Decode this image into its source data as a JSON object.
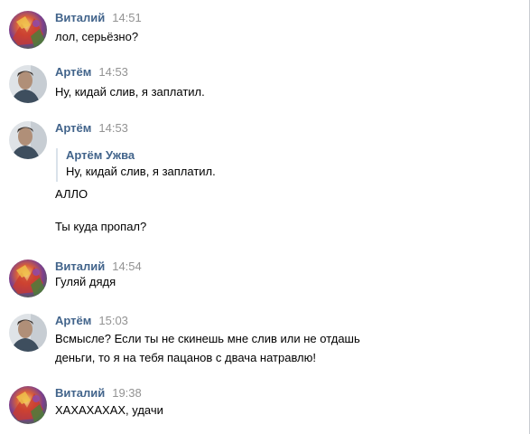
{
  "messages": [
    {
      "author": "Виталий",
      "time": "14:51",
      "avatar_icon": "vitaly-avatar-icon",
      "lines": [
        "лол, серьёзно?"
      ]
    },
    {
      "author": "Артём",
      "time": "14:53",
      "avatar_icon": "artem-avatar-icon",
      "lines": [
        "Ну, кидай слив, я заплатил."
      ]
    },
    {
      "author": "Артём",
      "time": "14:53",
      "avatar_icon": "artem-avatar-icon",
      "quote": {
        "author": "Артём Ужва",
        "text": "Ну, кидай слив, я заплатил."
      },
      "lines": [
        "АЛЛО",
        "Ты куда пропал?"
      ]
    },
    {
      "author": "Виталий",
      "time": "14:54",
      "avatar_icon": "vitaly-avatar-icon",
      "lines": [
        "Гуляй дядя"
      ]
    },
    {
      "author": "Артём",
      "time": "15:03",
      "avatar_icon": "artem-avatar-icon",
      "lines": [
        "Всмысле? Если ты не скинешь мне слив или не отдашь",
        "деньги, то я на тебя пацанов с двача натравлю!"
      ]
    },
    {
      "author": "Виталий",
      "time": "19:38",
      "avatar_icon": "vitaly-avatar-icon",
      "lines": [
        "ХАХАХАХАХ, удачи"
      ]
    }
  ],
  "colors": {
    "author": "#42648b",
    "time": "#939393",
    "quote_border": "#dae2ea",
    "text": "#000000"
  }
}
